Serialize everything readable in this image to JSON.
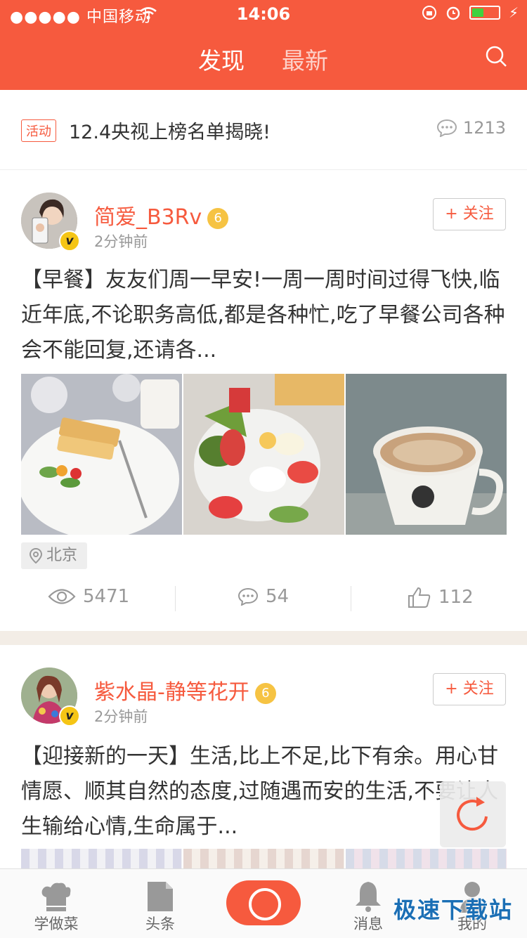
{
  "status_bar": {
    "carrier": "●●●●● 中国移动",
    "time": "14:06"
  },
  "header": {
    "tabs": [
      {
        "label": "发现",
        "active": true
      },
      {
        "label": "最新",
        "active": false
      }
    ],
    "search_icon": "search-icon"
  },
  "banner": {
    "tag": "活动",
    "title": "12.4央视上榜名单揭晓!",
    "comment_count": "1213"
  },
  "posts": [
    {
      "username": "简爱_B3Rv",
      "level": "6",
      "verified_badge": "v",
      "time": "2分钟前",
      "follow_label": "+ 关注",
      "text": "【早餐】友友们周一早安!一周一周时间过得飞快,临近年底,不论职务高低,都是各种忙,吃了早餐公司各种会不能回复,还请各...",
      "location": "北京",
      "views": "5471",
      "comments": "54",
      "likes": "112"
    },
    {
      "username": "紫水晶-静等花开",
      "level": "6",
      "verified_badge": "v",
      "time": "2分钟前",
      "follow_label": "+ 关注",
      "text": "【迎接新的一天】生活,比上不足,比下有余。用心甘情愿、顺其自然的态度,过随遇而安的生活,不要让人生输给心情,生命属于..."
    }
  ],
  "tabbar": {
    "items": [
      {
        "label": "学做菜",
        "icon": "chef-hat-icon"
      },
      {
        "label": "头条",
        "icon": "document-icon"
      },
      {
        "label": "",
        "icon": "camera-icon"
      },
      {
        "label": "消息",
        "icon": "bell-icon"
      },
      {
        "label": "我的",
        "icon": "person-icon"
      }
    ]
  },
  "watermark": "极速下载站",
  "colors": {
    "brand": "#f65a3e",
    "badge_gold": "#f6c343",
    "watermark_blue": "#1b6fb5"
  }
}
